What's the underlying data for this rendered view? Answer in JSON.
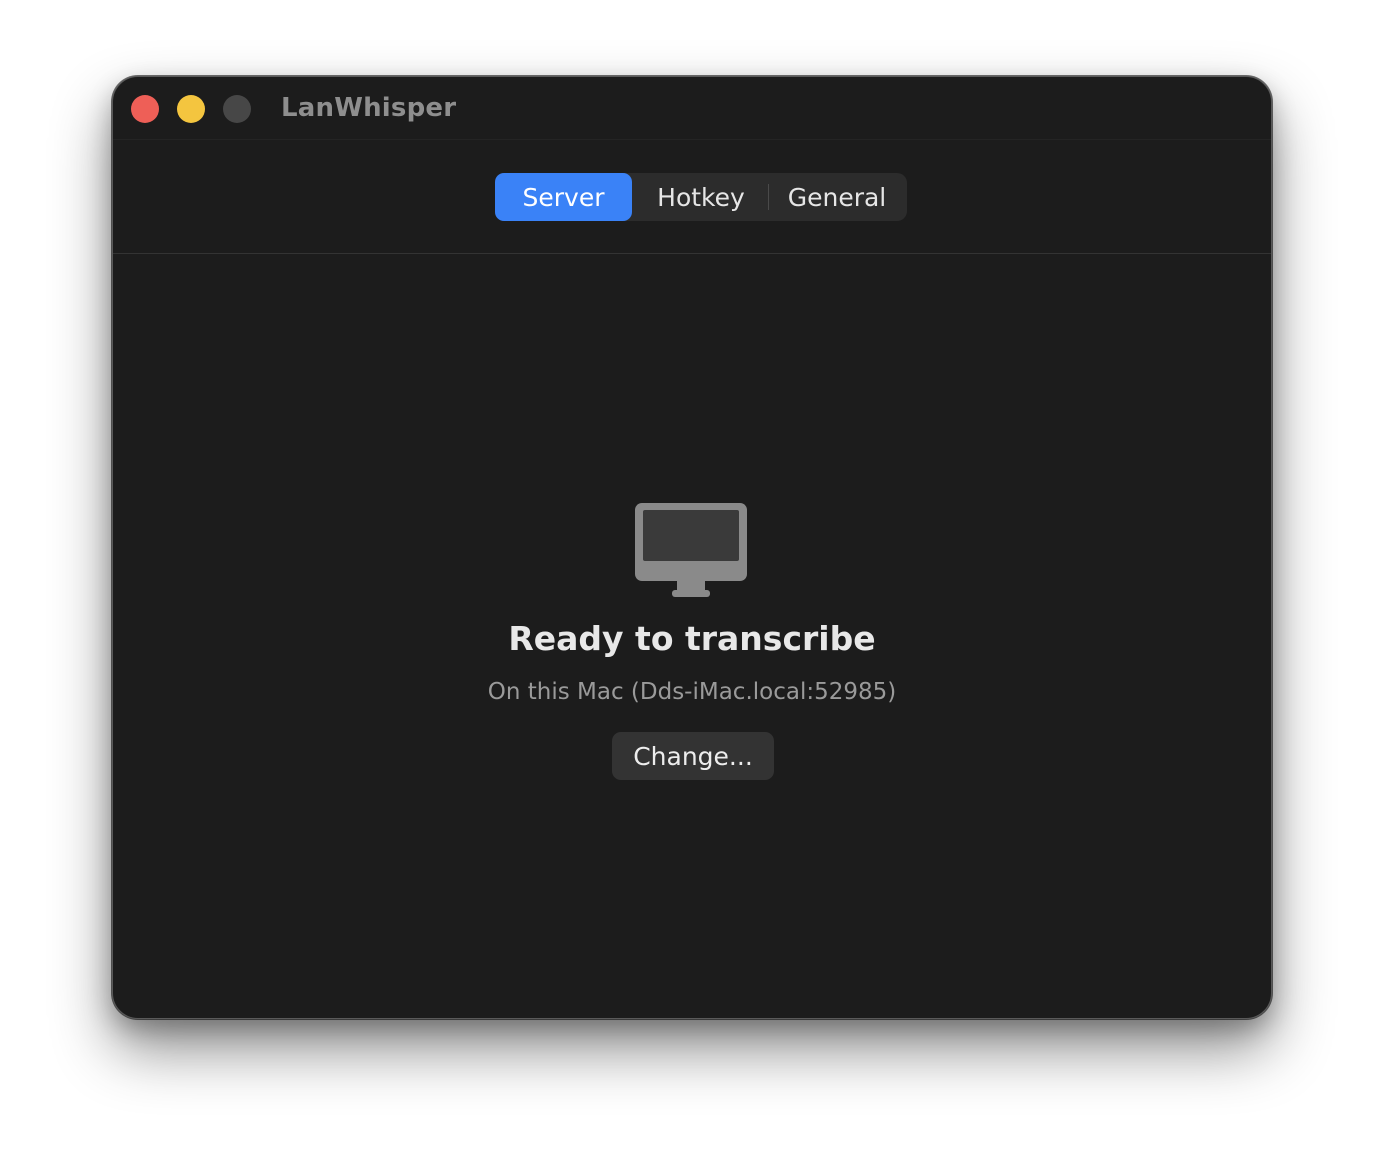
{
  "window": {
    "title": "LanWhisper"
  },
  "tabs": [
    {
      "label": "Server",
      "selected": true
    },
    {
      "label": "Hotkey",
      "selected": false
    },
    {
      "label": "General",
      "selected": false
    }
  ],
  "server": {
    "icon": "desktop-computer-icon",
    "status_title": "Ready to transcribe",
    "status_detail": "On this Mac (Dds-iMac.local:52985)",
    "change_label": "Change..."
  },
  "colors": {
    "accent": "#3a82f7",
    "close": "#ee5f57",
    "minimize": "#f4c53f",
    "zoom_disabled": "#474747",
    "background": "#1c1c1c"
  }
}
